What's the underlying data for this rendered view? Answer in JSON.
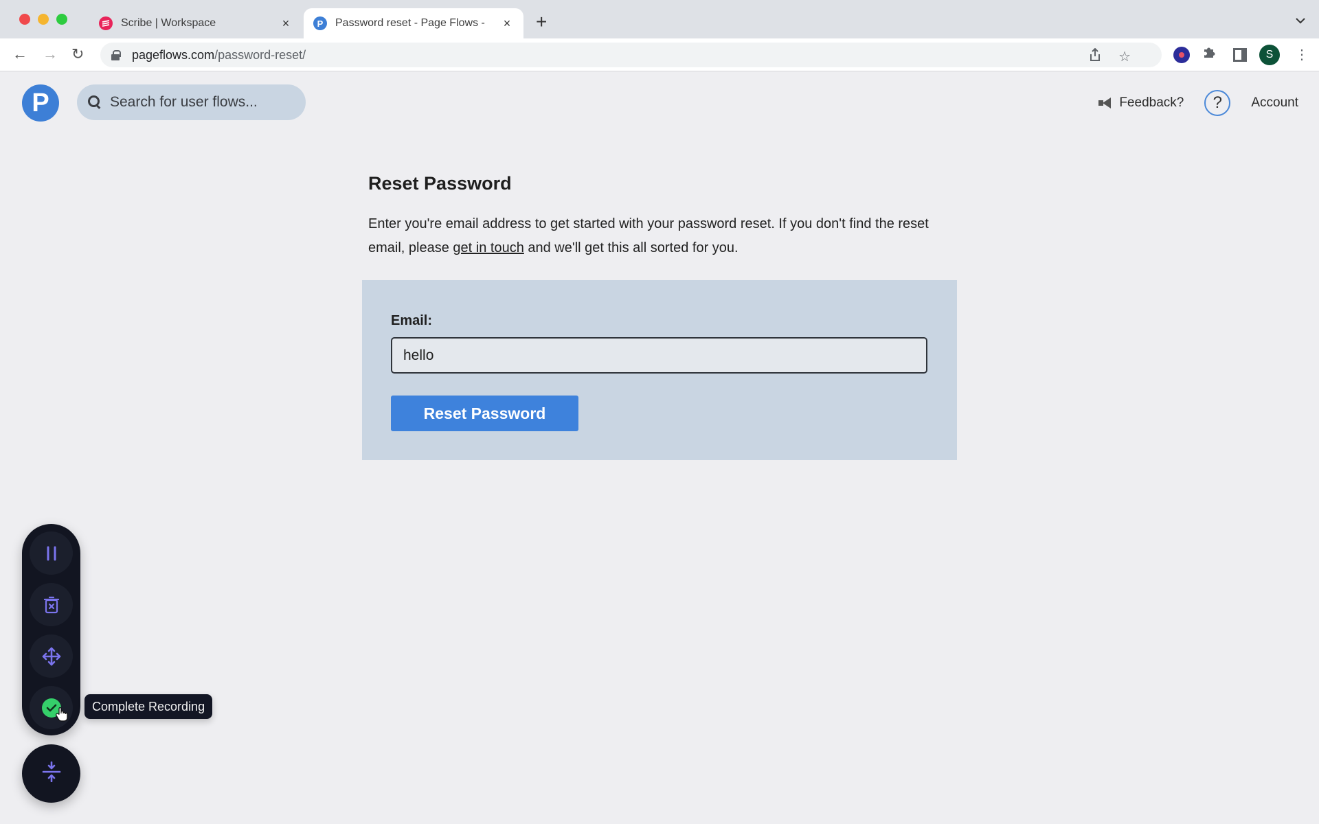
{
  "browser": {
    "tabs": [
      {
        "title": "Scribe | Workspace",
        "favicon": "scribe-logo",
        "active": false
      },
      {
        "title": "Password reset - Page Flows -",
        "favicon": "P",
        "active": true
      }
    ],
    "new_tab_label": "+",
    "url": {
      "host": "pageflows.com",
      "path": "/password-reset/"
    },
    "profile_initial": "S",
    "icons": {
      "back": "←",
      "forward": "→",
      "reload": "↻",
      "share": "⇪",
      "star": "☆",
      "puzzle": "✱",
      "kebab": "⋮",
      "tab_close": "×",
      "tab_menu": "⌄"
    }
  },
  "header": {
    "logo_letter": "P",
    "search_placeholder": "Search for user flows...",
    "feedback_label": "Feedback?",
    "help_label": "?",
    "account_label": "Account"
  },
  "main": {
    "title": "Reset Password",
    "intro_before": "Enter you're email address to get started with your password reset. If you don't find the reset email, please ",
    "intro_link": "get in touch",
    "intro_after": " and we'll get this all sorted for you.",
    "form": {
      "email_label": "Email:",
      "email_value": "hello",
      "submit_label": "Reset Password"
    }
  },
  "recorder": {
    "buttons": [
      "pause",
      "delete",
      "move",
      "complete"
    ],
    "tooltip": "Complete Recording",
    "colors": {
      "accent": "#7b74ee",
      "success": "#35d06a",
      "bg": "#121521"
    }
  }
}
